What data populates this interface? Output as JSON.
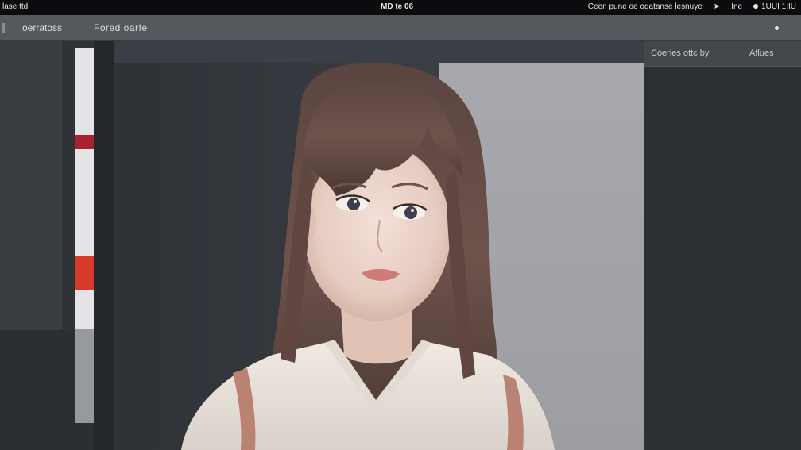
{
  "topbar": {
    "left_text": "lase ttd",
    "center_text": "MD te 06",
    "right_text": "Ceen pune oe ogatanse lesnuye",
    "right_item2": "Ine",
    "right_item3": "1UUI 1IIU"
  },
  "toolbar": {
    "tab1": "oerratoss",
    "tab2": "Fored oarfe"
  },
  "right_panel": {
    "header_left": "Coeries ottc by",
    "header_right": "Aflues"
  },
  "colors": {
    "accent_red": "#a8212e",
    "accent_orange_red": "#d63a2c",
    "panel_dark": "#2c2f34"
  },
  "icons": [
    "arrow-icon",
    "record-dot-icon",
    "menu-dot-icon"
  ]
}
